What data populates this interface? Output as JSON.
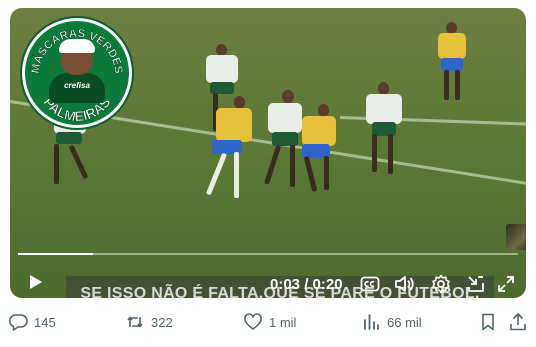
{
  "video": {
    "subtitle": "SE ISSO NÃO É FALTA,QUE SE PARE O FUTEBOL.",
    "current_time": "0:03",
    "duration": "0:20",
    "time_display": "0:03 / 0:20",
    "progress": 0.15
  },
  "watermark": {
    "top_text": "MÁSCARAS VERDES",
    "bottom_text": "PALMEIRAS",
    "sponsor": "crefisa"
  },
  "controls": {
    "play_icon": "play-icon",
    "captions_icon": "captions-icon",
    "volume_icon": "volume-icon",
    "settings_icon": "gear-icon",
    "pip_icon": "picture-in-picture-icon",
    "fullscreen_icon": "fullscreen-icon"
  },
  "actions": {
    "replies": "145",
    "reposts": "322",
    "likes": "1 mil",
    "views": "66 mil"
  },
  "colors": {
    "action_gray": "#536471",
    "pitch_green": "#5f7a36",
    "palmeiras_green": "#0c7a3a",
    "brazil_yellow": "#e8c43a"
  }
}
